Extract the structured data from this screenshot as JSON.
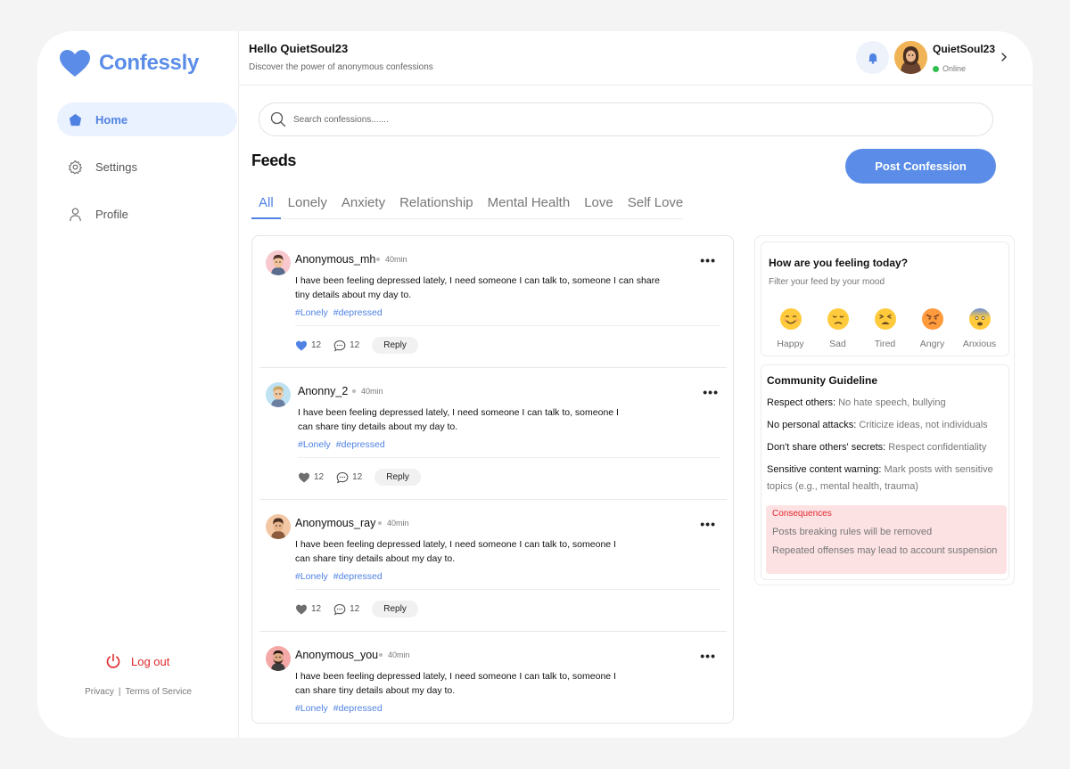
{
  "brand": {
    "name": "Confessly",
    "color": "#5b8de8"
  },
  "nav": [
    {
      "label": "Home",
      "icon": "home-icon",
      "active": true
    },
    {
      "label": "Settings",
      "icon": "gear-icon",
      "active": false
    },
    {
      "label": "Profile",
      "icon": "user-icon",
      "active": false
    }
  ],
  "logout_label": "Log out",
  "legal": {
    "privacy": "Privacy",
    "separator": "|",
    "terms": "Terms of Service"
  },
  "header": {
    "greeting": "Hello QuietSoul23",
    "subtitle": "Discover the power of anonymous confessions",
    "user": {
      "name": "QuietSoul23",
      "status": "Online"
    }
  },
  "search": {
    "placeholder": "Search confessions......."
  },
  "feeds_title": "Feeds",
  "post_button": "Post Confession",
  "tabs": [
    "All",
    "Lonely",
    "Anxiety",
    "Relationship",
    "Mental Health",
    "Love",
    "Self Love"
  ],
  "posts": [
    {
      "author": "Anonymous_mh",
      "time": "40min",
      "text": "I have been feeling depressed lately, I need someone I can talk to, someone I can share tiny details about my day to.",
      "tags": [
        "#Lonely",
        "#depressed"
      ],
      "likes": "12",
      "comments": "12",
      "reply": "Reply",
      "liked": true
    },
    {
      "author": "Anonny_2",
      "time": "40min",
      "text": "I have been feeling depressed lately, I need someone I can talk to, someone I can share tiny details about my day to.",
      "tags": [
        "#Lonely",
        "#depressed"
      ],
      "likes": "12",
      "comments": "12",
      "reply": "Reply",
      "liked": false
    },
    {
      "author": "Anonymous_ray",
      "time": "40min",
      "text": "I have been feeling depressed lately, I need someone I can talk to, someone I can share tiny details about my day to.",
      "tags": [
        "#Lonely",
        "#depressed"
      ],
      "likes": "12",
      "comments": "12",
      "reply": "Reply",
      "liked": false
    },
    {
      "author": "Anonymous_you",
      "time": "40min",
      "text": "I have been feeling depressed lately, I need someone I can talk to, someone I can share tiny details about my day to.",
      "tags": [
        "#Lonely",
        "#depressed"
      ]
    }
  ],
  "mood": {
    "title": "How are you feeling today?",
    "subtitle": "Filter your feed by your mood",
    "options": [
      {
        "label": "Happy",
        "icon": "happy-emoji-icon"
      },
      {
        "label": "Sad",
        "icon": "sad-emoji-icon"
      },
      {
        "label": "Tired",
        "icon": "tired-emoji-icon"
      },
      {
        "label": "Angry",
        "icon": "angry-emoji-icon"
      },
      {
        "label": "Anxious",
        "icon": "anxious-emoji-icon"
      }
    ]
  },
  "guideline": {
    "title": "Community Guideline",
    "rules": [
      {
        "term": "Respect others:",
        "desc": "No hate speech, bullying"
      },
      {
        "term": "No personal attacks:",
        "desc": "Criticize ideas, not individuals"
      },
      {
        "term": "Don't share others' secrets:",
        "desc": "Respect confidentiality"
      },
      {
        "term": "Sensitive content warning:",
        "desc": "Mark posts with sensitive topics (e.g., mental health, trauma)"
      }
    ],
    "consequences": {
      "title": "Consequences",
      "items": [
        "Posts breaking rules will be removed",
        "Repeated offenses may lead to account suspension"
      ]
    }
  }
}
